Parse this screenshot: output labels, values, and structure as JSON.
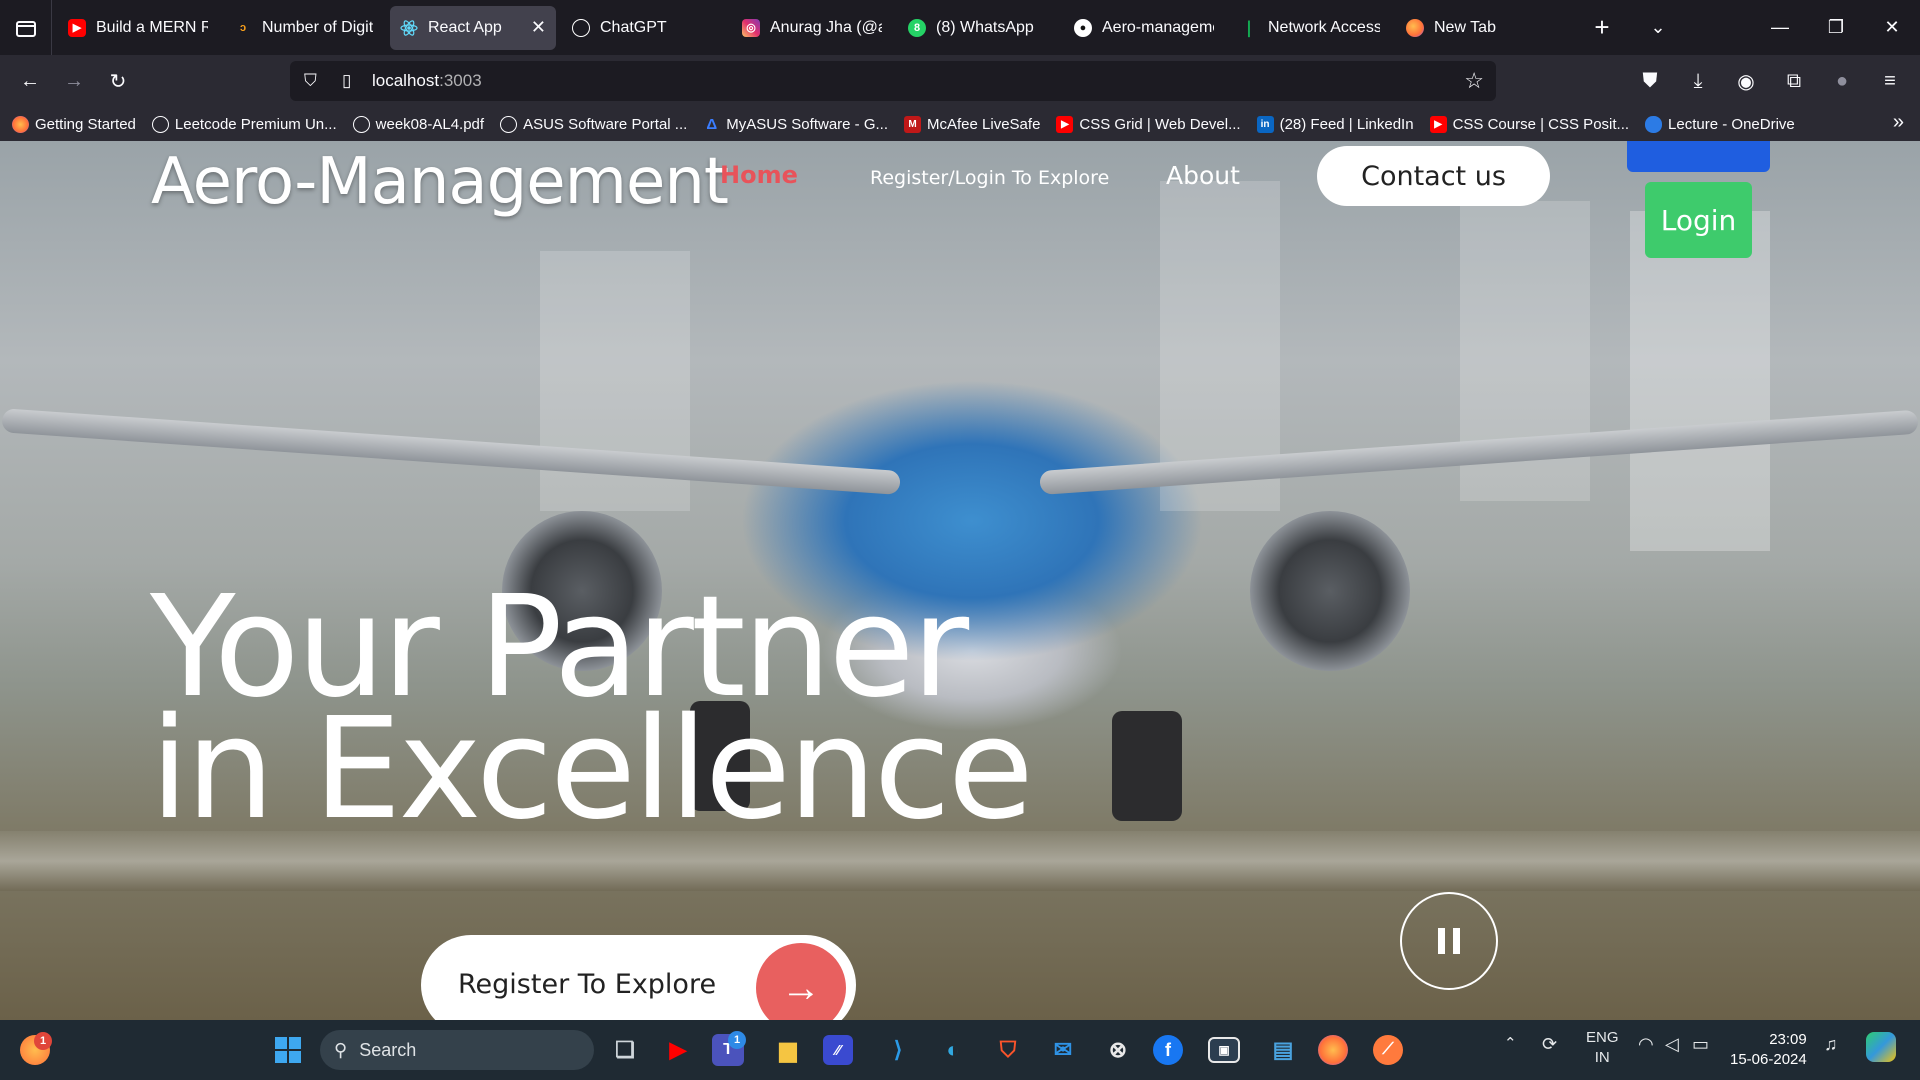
{
  "browser": {
    "tabs": [
      {
        "title": "Build a MERN Re",
        "icon": "youtube-icon",
        "color": "#ff0000"
      },
      {
        "title": "Number of Digit",
        "icon": "leetcode-icon",
        "color": "#f89f1b"
      },
      {
        "title": "React App",
        "icon": "react-icon",
        "color": "#61dafb",
        "active": true
      },
      {
        "title": "ChatGPT",
        "icon": "chatgpt-icon",
        "color": "#ffffff"
      },
      {
        "title": "Anurag Jha (@anu",
        "icon": "instagram-icon",
        "color": "#e1306c"
      },
      {
        "title": "(8) WhatsApp",
        "icon": "whatsapp-icon",
        "color": "#25d366"
      },
      {
        "title": "Aero-manageme",
        "icon": "github-icon",
        "color": "#ffffff"
      },
      {
        "title": "Network Access |",
        "icon": "mongodb-icon",
        "color": "#13aa52"
      },
      {
        "title": "New Tab",
        "icon": "firefox-icon",
        "color": "#ff7139"
      }
    ],
    "url_host": "localhost",
    "url_port": ":3003",
    "bookmarks": [
      {
        "label": "Getting Started",
        "icon": "firefox-icon",
        "color": "#ff7139"
      },
      {
        "label": "Leetcode Premium Un...",
        "icon": "globe-icon",
        "color": "#555"
      },
      {
        "label": "week08-AL4.pdf",
        "icon": "globe-icon",
        "color": "#555"
      },
      {
        "label": "ASUS Software Portal ...",
        "icon": "globe-icon",
        "color": "#555"
      },
      {
        "label": "MyASUS Software - G...",
        "icon": "myasus-icon",
        "color": "#3b7dff"
      },
      {
        "label": "McAfee LiveSafe",
        "icon": "mcafee-icon",
        "color": "#c01818"
      },
      {
        "label": "CSS Grid | Web Devel...",
        "icon": "youtube-icon",
        "color": "#ff0000"
      },
      {
        "label": "(28) Feed | LinkedIn",
        "icon": "linkedin-icon",
        "color": "#0a66c2"
      },
      {
        "label": "CSS Course | CSS Posit...",
        "icon": "youtube-icon",
        "color": "#ff0000"
      },
      {
        "label": "Lecture - OneDrive",
        "icon": "onedrive-icon",
        "color": "#2c7be5"
      }
    ]
  },
  "site": {
    "brand": "Aero-Management",
    "nav": {
      "home": "Home",
      "register_login": "Register/Login To Explore",
      "about": "About",
      "contact": "Contact us"
    },
    "login_button": "Login",
    "hero_line1": "Your Partner",
    "hero_line2": "in Excellence",
    "cta_label": "Register To Explore",
    "accent_color": "#e8605f"
  },
  "taskbar": {
    "search_placeholder": "Search",
    "language": "ENG",
    "region": "IN",
    "time": "23:09",
    "date": "15-06-2024"
  }
}
